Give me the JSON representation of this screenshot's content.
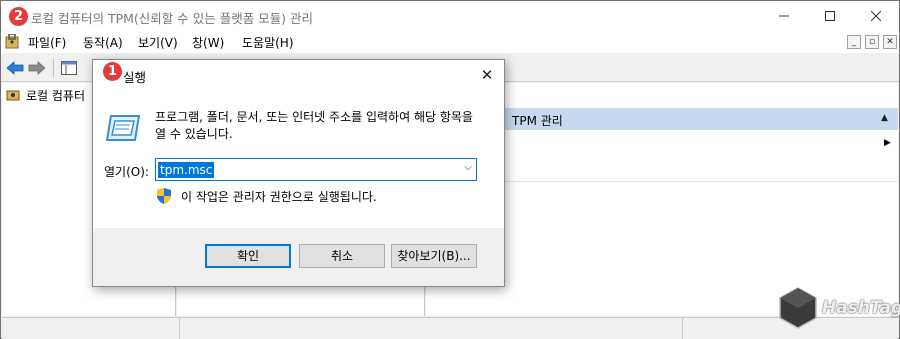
{
  "main_window": {
    "title": "로컬 컴퓨터의 TPM(신뢰할 수 있는 플랫폼 모듈) 관리",
    "badge": "2",
    "menu": [
      "파일(F)",
      "동작(A)",
      "보기(V)",
      "창(W)",
      "도움말(H)"
    ],
    "tree_root": "로컬 컴퓨터",
    "action_pane": {
      "header": "TPM 관리"
    }
  },
  "run_dialog": {
    "badge": "1",
    "title": "실행",
    "description": "프로그램, 폴더, 문서, 또는 인터넷 주소를 입력하여 해당 항목을 열 수 있습니다.",
    "open_label": "열기(O):",
    "open_value": "tpm.msc",
    "admin_note": "이 작업은 관리자 권한으로 실행됩니다.",
    "ok_label": "확인",
    "cancel_label": "취소",
    "browse_label": "찾아보기(B)..."
  },
  "watermark": {
    "text": "HashTag"
  },
  "colors": {
    "accent": "#0078d7",
    "badge": "#e63b3b",
    "action_header": "#c6d9ee"
  }
}
